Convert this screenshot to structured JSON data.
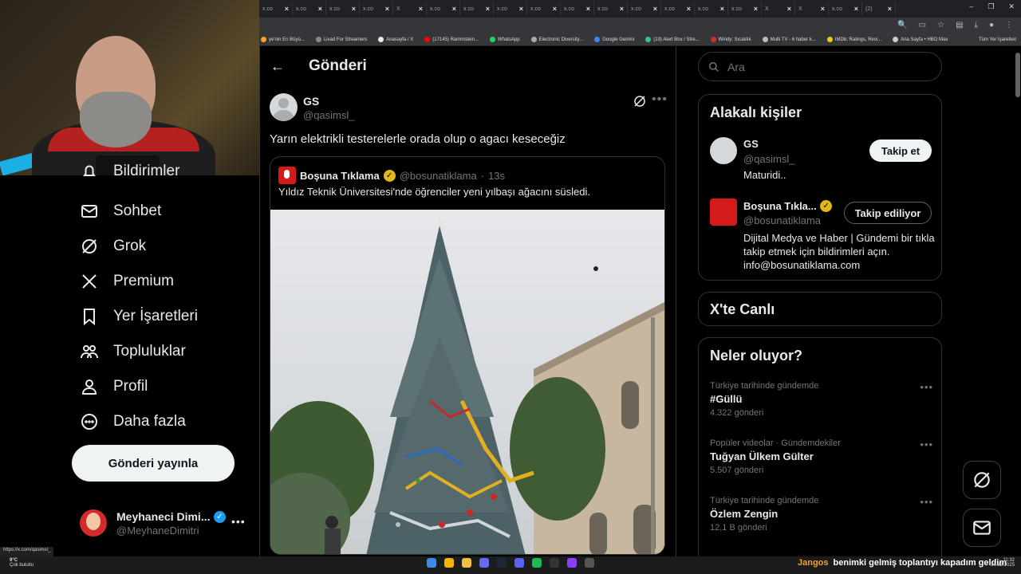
{
  "browser": {
    "tab_labels": [
      "x.co",
      "x.co",
      "x.co",
      "x.co",
      "X",
      "x.co",
      "x.co",
      "x.co",
      "x.co",
      "x.co",
      "x.co",
      "x.co",
      "x.co",
      "x.co",
      "x.co",
      "X",
      "X",
      "x.co",
      "(2)"
    ],
    "bookmarks": [
      "ye'nin En Büyü...",
      "Livad For Streamers",
      "Anasayfa / X",
      "(17145) Rammstein...",
      "WhatsApp",
      "Electronic Diversity...",
      "Google Gemini",
      "(19) Alert Box / Stre...",
      "Windy: Sıcaklık",
      "Multi TV - 6 haber k...",
      "IMDb: Ratings, Revi...",
      "Ana Sayfa • HBO Max"
    ],
    "bookmarks_folder": "Tüm Yer İşaretleri",
    "bookmark_colors": [
      "#f4a623",
      "#888888",
      "#e7e9ea",
      "#ff0000",
      "#25d366",
      "#aaaaaa",
      "#4285f4",
      "#31c48d",
      "#d62d20",
      "#bbbbbb",
      "#f5c518",
      "#cccccc"
    ]
  },
  "sidebar": {
    "partial_item": "Bildirimler",
    "items": [
      {
        "label": "Sohbet",
        "icon": "mail-icon"
      },
      {
        "label": "Grok",
        "icon": "grok-icon"
      },
      {
        "label": "Premium",
        "icon": "x-logo-icon"
      },
      {
        "label": "Yer İşaretleri",
        "icon": "bookmark-icon"
      },
      {
        "label": "Topluluklar",
        "icon": "communities-icon"
      },
      {
        "label": "Profil",
        "icon": "person-icon"
      },
      {
        "label": "Daha fazla",
        "icon": "more-circle-icon"
      }
    ],
    "post_button": "Gönderi yayınla",
    "account": {
      "name": "Meyhaneci Dimi...",
      "handle": "@MeyhaneDimitri"
    }
  },
  "main": {
    "header_title": "Gönderi",
    "tweet": {
      "author_name": "GS",
      "author_handle": "@qasimsl_",
      "text": "Yarın elektrikli testerelerle orada olup o agacı keseceğiz"
    },
    "quote": {
      "name": "Boşuna Tıklama",
      "handle": "@bosunatiklama",
      "separator": "·",
      "time": "13s",
      "text": "Yıldız Teknik Üniversitesi'nde öğrenciler yeni yılbaşı ağacını süsledi."
    }
  },
  "right": {
    "search_placeholder": "Ara",
    "related": {
      "title": "Alakalı kişiler",
      "people": [
        {
          "name": "GS",
          "handle": "@qasimsl_",
          "bio": "Maturidi..",
          "button": "Takip et"
        },
        {
          "name": "Boşuna Tıkla...",
          "handle": "@bosunatiklama",
          "bio": "Dijital Medya ve Haber | Gündemi bir tıkla takip etmek için bildirimleri açın. info@bosunatiklama.com",
          "button": "Takip ediliyor"
        }
      ]
    },
    "live_title": "X'te Canlı",
    "trends_title": "Neler oluyor?",
    "trends": [
      {
        "meta": "Türkiye tarihinde gündemde",
        "topic": "#Güllü",
        "count": "4.322 gönderi"
      },
      {
        "meta": "Popüler videolar · Gündemdekiler",
        "topic": "Tuğyan Ülkem Gülter",
        "count": "5.507 gönderi"
      },
      {
        "meta": "Türkiye tarihinde gündemde",
        "topic": "Özlem Zengin",
        "count": "12,1 B gönderi"
      }
    ]
  },
  "status_url": "https://x.com/qasimsl_",
  "taskbar": {
    "weather_temp": "9°C",
    "weather_desc": "Çok bulutlu",
    "ticker_user": "Jangos",
    "ticker_text": "benimki gelmiş toplantıyı kapadım geldim",
    "time": "11:32",
    "date": "10.12.2025"
  }
}
